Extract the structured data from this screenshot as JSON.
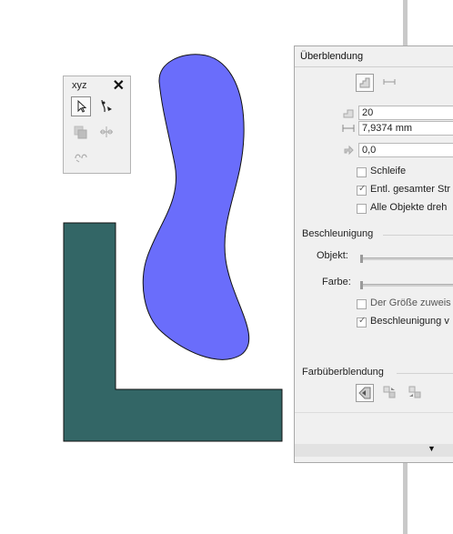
{
  "toolbar": {
    "title": "xyz",
    "close_icon": "close-icon",
    "tools": [
      "pick-tool-icon",
      "blend-tool-icon",
      "contour-tool-icon",
      "distort-tool-icon",
      "envelope-tool-icon"
    ]
  },
  "canvas": {
    "blob_color": "#6a6dfb",
    "l_shape_color": "#336666"
  },
  "docker": {
    "title": "Überblendung",
    "steps_value": "20",
    "spacing_value": "7,9374 mm",
    "rotation_value": "0,0",
    "loop_label": "Schleife",
    "loop_checked": false,
    "full_path_label": "Entl. gesamter Str",
    "full_path_checked": true,
    "rotate_all_label": "Alle Objekte dreh",
    "rotate_all_checked": false,
    "acceleration_section": "Beschleunigung",
    "object_label": "Objekt:",
    "color_label": "Farbe:",
    "size_label": "Der Größe zuweis",
    "size_checked": false,
    "accel_label": "Beschleunigung v",
    "accel_checked": true,
    "color_blend_section": "Farbüberblendung",
    "footer_icon": "chevron-down-icon"
  }
}
